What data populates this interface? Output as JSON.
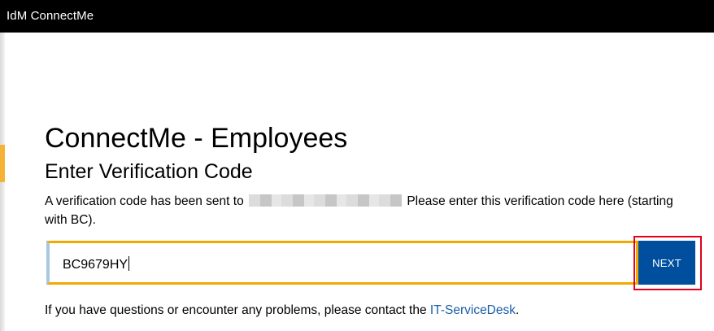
{
  "header": {
    "app_title": "IdM ConnectMe"
  },
  "main": {
    "title": "ConnectMe - Employees",
    "subtitle": "Enter Verification Code",
    "description_before": "A verification code has been sent to",
    "description_after": "Please enter this verification code here (starting with BC).",
    "code_input_value": "BC9679HY",
    "next_label": "NEXT",
    "help_text": "If you have questions or encounter any problems, please contact the",
    "help_link": "IT-ServiceDesk",
    "help_suffix": "."
  },
  "colors": {
    "topbar": "#000000",
    "input_border": "#f2a900",
    "button": "#004f9f",
    "highlight": "#e2001a",
    "link": "#1a5fa8"
  }
}
